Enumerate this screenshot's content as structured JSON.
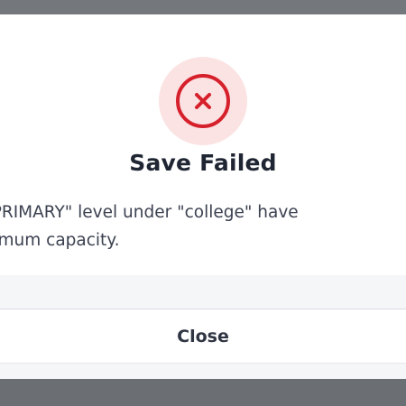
{
  "dialog": {
    "title": "Save Failed",
    "message_line1": "Applications for \"PRIMARY\" level under \"college\" have",
    "message_line2": "reached the maximum capacity.",
    "close_label": "Close",
    "icon": "error-x-circle-icon"
  },
  "colors": {
    "error_red": "#d6202c",
    "icon_bg": "#fbe3e3",
    "backdrop": "#6f7277"
  }
}
